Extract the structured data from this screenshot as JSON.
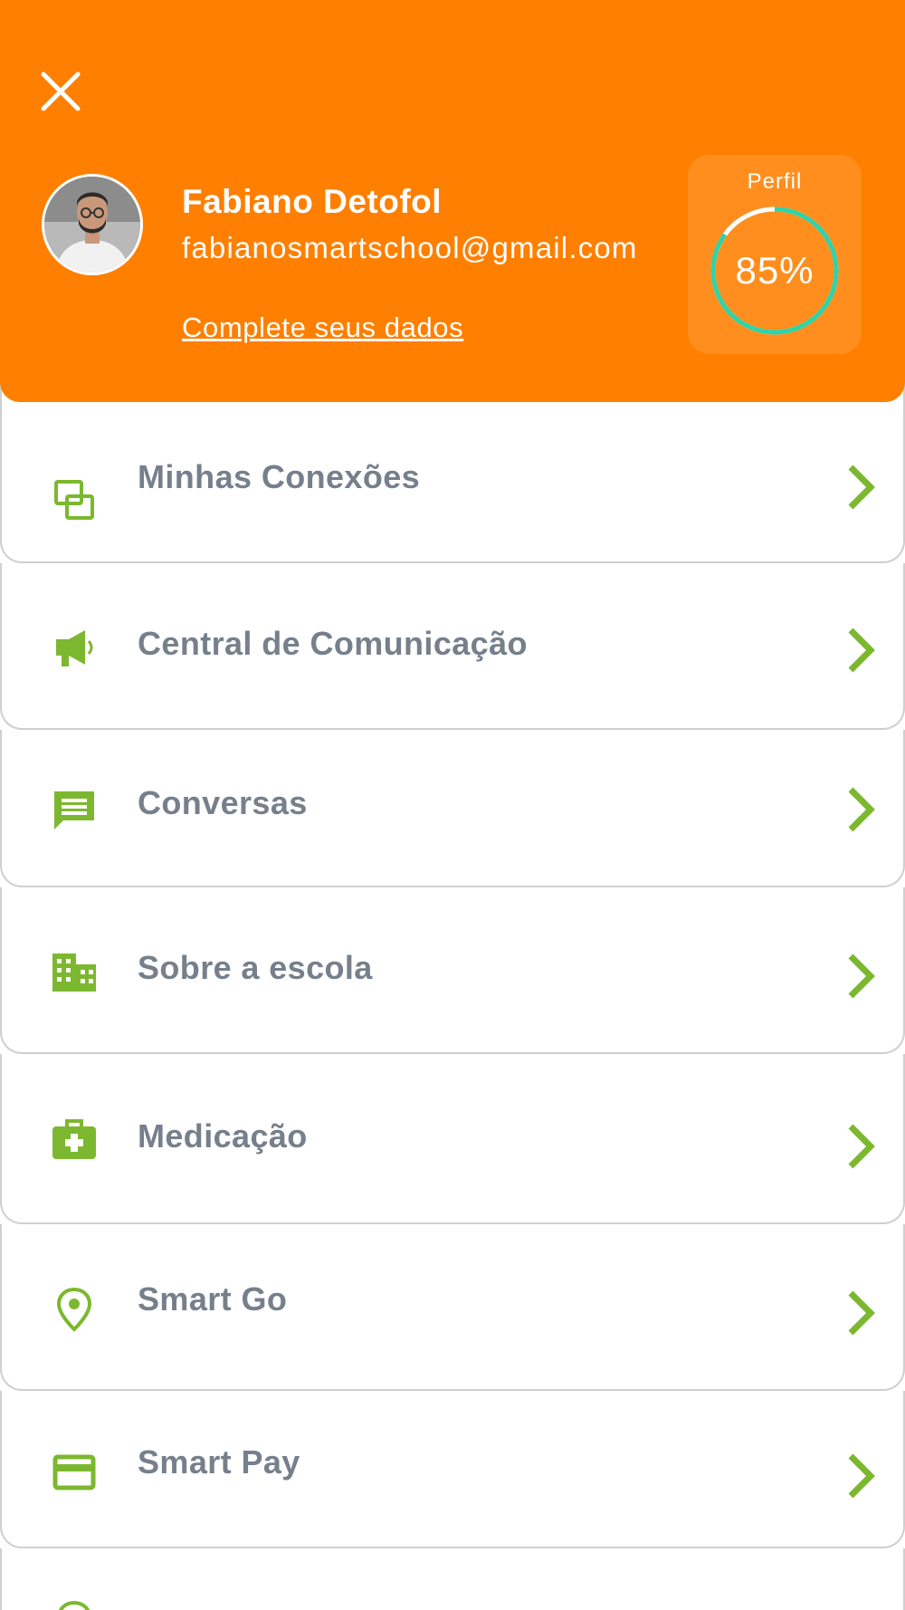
{
  "colors": {
    "accent": "#ff7f00",
    "profile_card": "#ff8e1e",
    "progress_ring": "#2ed3a8",
    "icon_green": "#7cb82f",
    "menu_text": "#76808c"
  },
  "header": {
    "close_icon": "close-icon",
    "user": {
      "name": "Fabiano Detofol",
      "email": "fabianosmartschool@gmail.com",
      "complete_link": "Complete seus dados"
    },
    "profile": {
      "label": "Perfil",
      "progress_percent": 85,
      "progress_text": "85%"
    }
  },
  "menu": {
    "items": [
      {
        "label": "Minhas Conexões",
        "icon": "connections-icon"
      },
      {
        "label": "Central de Comunicação",
        "icon": "megaphone-icon"
      },
      {
        "label": "Conversas",
        "icon": "chat-icon"
      },
      {
        "label": "Sobre a escola",
        "icon": "building-icon"
      },
      {
        "label": "Medicação",
        "icon": "medical-kit-icon"
      },
      {
        "label": "Smart Go",
        "icon": "location-pin-icon"
      },
      {
        "label": "Smart Pay",
        "icon": "credit-card-icon"
      },
      {
        "label": "",
        "icon": "location-pin-icon"
      }
    ]
  }
}
